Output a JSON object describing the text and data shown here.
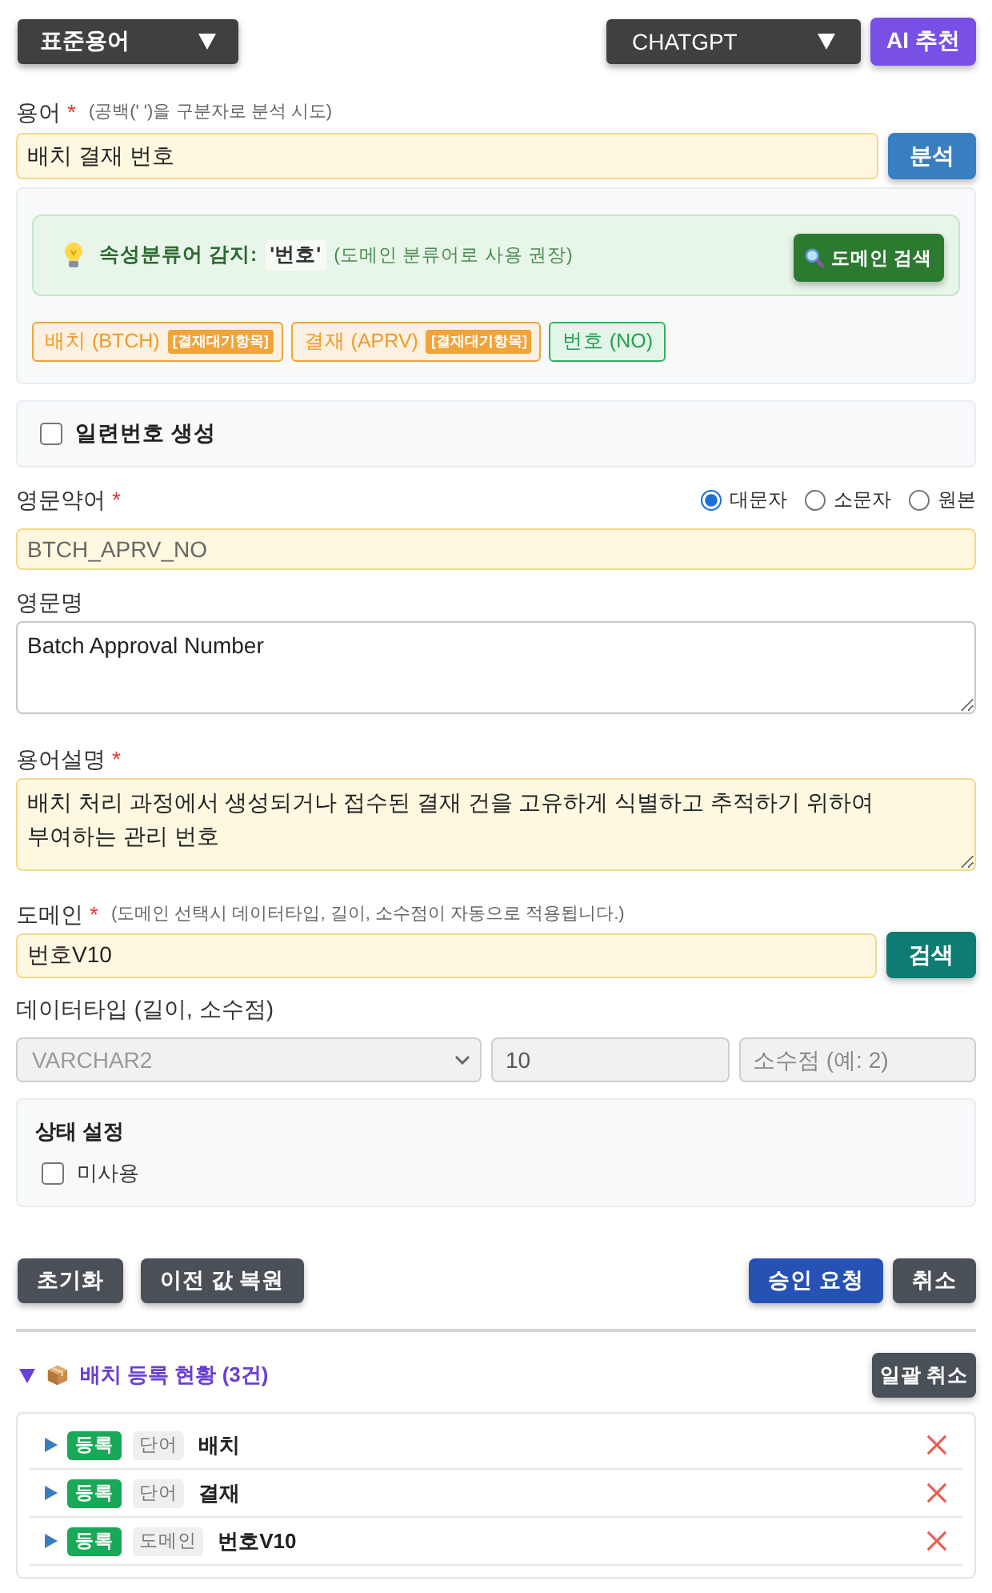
{
  "toolbar": {
    "term_type": "표준용어",
    "ai_model": "CHATGPT",
    "ai_button": "AI 추천"
  },
  "term": {
    "label": "용어",
    "mark": "*",
    "hint": "(공백(' ')을 구분자로 분석 시도)",
    "value": "배치 결재 번호",
    "highlighted": true,
    "button": "분석"
  },
  "analysis": {
    "detection": {
      "label": "속성분류어 감지:",
      "word": "'번호'",
      "note": "(도메인 분류어로 사용 권장)",
      "button": "도메인 검색"
    },
    "chips": [
      {
        "kind": "pending",
        "text": "배치 (BTCH)",
        "badge": "[결재대기항목]"
      },
      {
        "kind": "pending",
        "text": "결재 (APRV)",
        "badge": "[결재대기항목]"
      },
      {
        "kind": "matched",
        "text": "번호 (NO)"
      }
    ]
  },
  "serial": {
    "label": "일련번호 생성",
    "checked": false
  },
  "abbreviation": {
    "label": "영문약어",
    "mark": "*",
    "case_options": [
      {
        "label": "대문자",
        "selected": true
      },
      {
        "label": "소문자",
        "selected": false
      },
      {
        "label": "원본",
        "selected": false
      }
    ],
    "value": "BTCH_APRV_NO",
    "highlighted": true,
    "readonly": true
  },
  "english_name": {
    "label": "영문명",
    "value": "Batch Approval Number",
    "highlighted": false
  },
  "description": {
    "label": "용어설명",
    "mark": "*",
    "value": "배치 처리 과정에서 생성되거나 접수된 결재 건을 고유하게 식별하고 추적하기 위하여 부여하는 관리 번호",
    "highlighted": true
  },
  "domain": {
    "label": "도메인",
    "mark": "*",
    "hint": "(도메인 선택시 데이터타입, 길이, 소수점이 자동으로 적용됩니다.)",
    "value": "번호V10",
    "highlighted": true,
    "button": "검색"
  },
  "data_type": {
    "label": "데이터타입 (길이, 소수점)",
    "disabled": true,
    "type": {
      "value": "VARCHAR2"
    },
    "length": {
      "value": "10"
    },
    "scale": {
      "placeholder": "소수점 (예: 2)"
    }
  },
  "status_settings": {
    "title": "상태 설정",
    "options": [
      {
        "label": "미사용",
        "checked": false
      }
    ]
  },
  "actions": {
    "left": [
      {
        "label": "초기화",
        "kind": "secondary"
      },
      {
        "label": "이전 값 복원",
        "kind": "secondary"
      }
    ],
    "right": [
      {
        "label": "승인 요청",
        "kind": "primary"
      },
      {
        "label": "취소",
        "kind": "secondary"
      }
    ]
  },
  "batch": {
    "title": "배치 등록 현황 (3건)",
    "expanded": true,
    "button": "일괄 취소",
    "items": [
      {
        "status": "등록",
        "type": "단어",
        "name": "배치",
        "expanded": false
      },
      {
        "status": "등록",
        "type": "단어",
        "name": "결재",
        "expanded": false
      },
      {
        "status": "등록",
        "type": "도메인",
        "name": "번호V10",
        "expanded": false
      }
    ]
  }
}
